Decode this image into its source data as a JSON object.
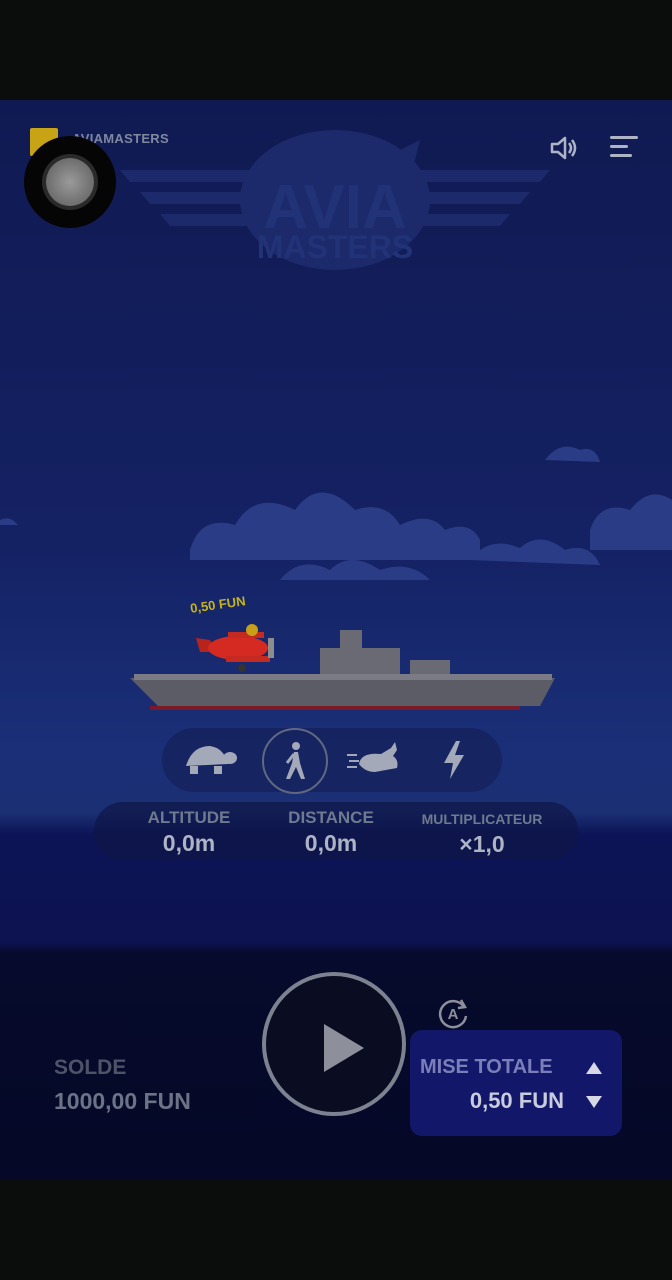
{
  "header": {
    "game_title": "AVIAMASTERS",
    "icons": [
      "sound-icon",
      "menu-icon"
    ]
  },
  "bet_tag": "0,50 FUN",
  "speed": {
    "options": [
      "turtle-icon",
      "walk-icon",
      "rabbit-icon",
      "lightning-icon"
    ],
    "selected": 1
  },
  "stats": {
    "altitude_label": "ALTITUDE",
    "altitude_value": "0,0m",
    "distance_label": "DISTANCE",
    "distance_value": "0,0m",
    "multiplier_label": "MULTIPLICATEUR",
    "multiplier_value": "×1,0"
  },
  "balance": {
    "label": "SOLDE",
    "value": "1000,00 FUN"
  },
  "bet": {
    "label": "MISE TOTALE",
    "value": "0,50 FUN"
  },
  "colors": {
    "sky": "#142163",
    "sea": "#0c1457",
    "bet_panel": "#12176a",
    "bet_tag": "#c7b515",
    "plane": "#d42a22"
  }
}
